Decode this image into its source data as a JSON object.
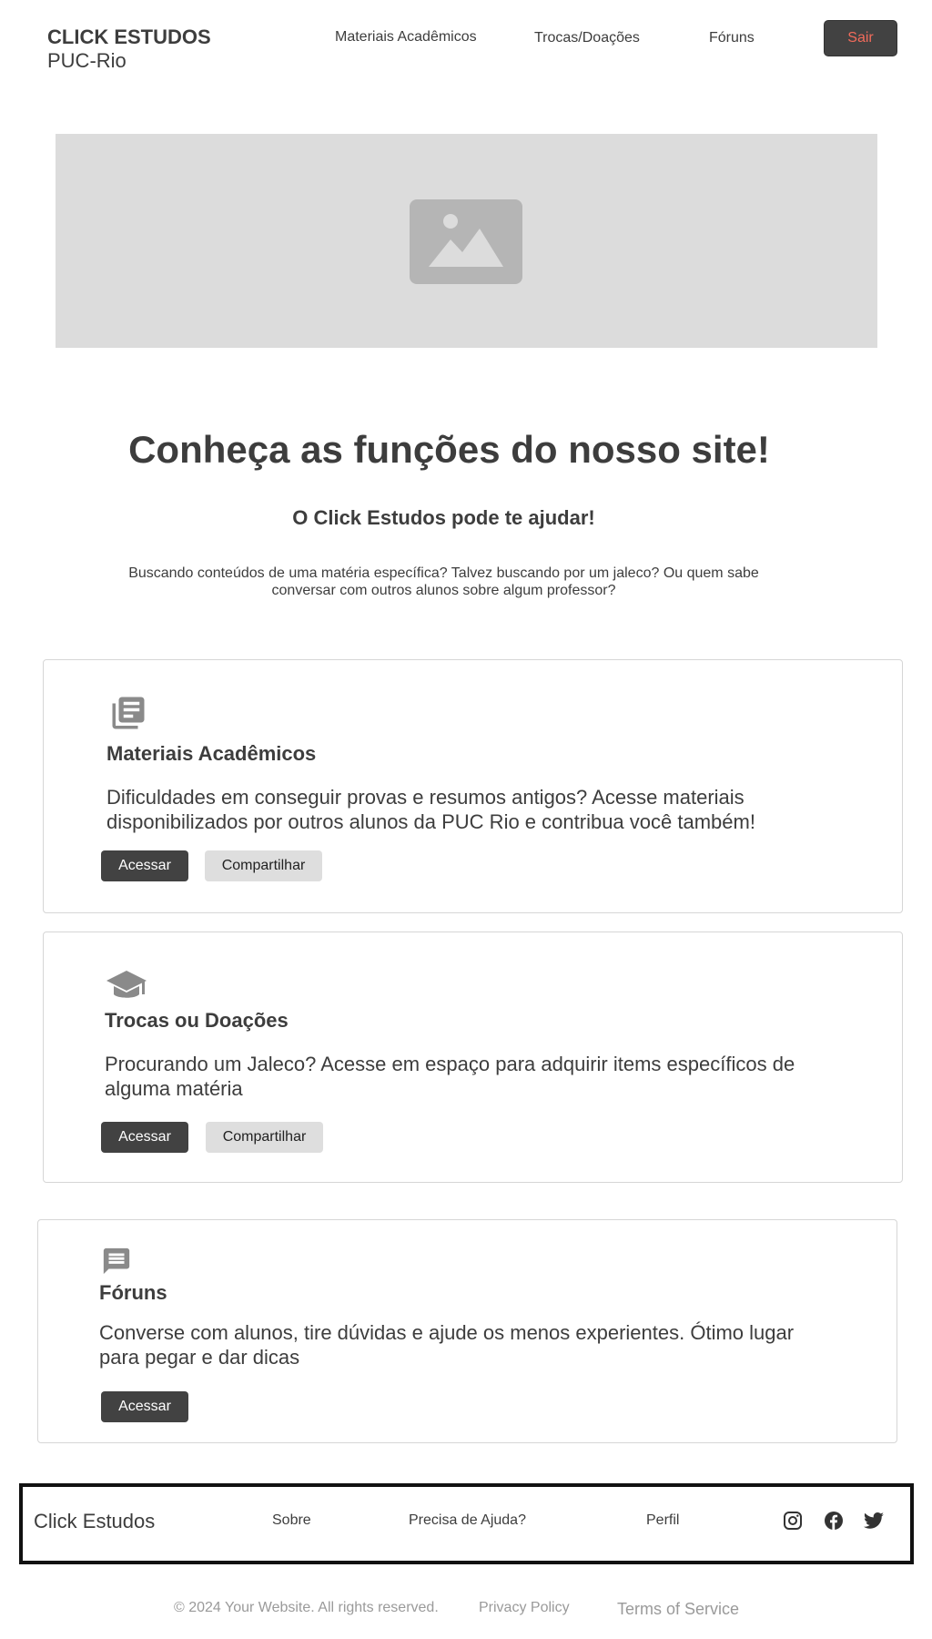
{
  "header": {
    "brand_title": "CLICK ESTUDOS",
    "brand_subtitle": "PUC-Rio",
    "nav": [
      {
        "label": "Materiais Acadêmicos"
      },
      {
        "label": "Trocas/Doações"
      },
      {
        "label": "Fóruns"
      }
    ],
    "logout_label": "Sair"
  },
  "hero": {
    "icon": "image-placeholder-icon"
  },
  "intro": {
    "title": "Conheça as funções do nosso site!",
    "subtitle": "O Click Estudos pode te ajudar!",
    "description": "Buscando conteúdos de uma matéria específica? Talvez buscando por um jaleco? Ou quem sabe conversar com outros alunos sobre algum professor?"
  },
  "cards": [
    {
      "icon": "library-books-icon",
      "title": "Materiais Acadêmicos",
      "description": "Dificuldades em conseguir provas e resumos antigos? Acesse materiais disponibilizados por outros alunos da PUC Rio e contribua você também!",
      "primary_label": "Acessar",
      "secondary_label": "Compartilhar"
    },
    {
      "icon": "graduation-cap-icon",
      "title": "Trocas ou Doações",
      "description": "Procurando um Jaleco? Acesse em espaço para adquirir items específicos de alguma matéria",
      "primary_label": "Acessar",
      "secondary_label": "Compartilhar"
    },
    {
      "icon": "chat-bubble-icon",
      "title": "Fóruns",
      "description": "Converse com alunos, tire dúvidas e ajude os menos experientes. Ótimo lugar para pegar e dar dicas",
      "primary_label": "Acessar"
    }
  ],
  "footer": {
    "brand": "Click Estudos",
    "links": [
      {
        "label": "Sobre"
      },
      {
        "label": "Precisa de Ajuda?"
      },
      {
        "label": "Perfil"
      }
    ],
    "social": [
      "instagram-icon",
      "facebook-icon",
      "twitter-icon"
    ],
    "copyright": "© 2024 Your Website. All rights reserved.",
    "privacy": "Privacy Policy",
    "terms": "Terms of Service"
  },
  "colors": {
    "primary_button": "#424242",
    "logout_text": "#f26b5b",
    "hero_bg": "#dcdcdc",
    "text": "#3d3d3d"
  }
}
